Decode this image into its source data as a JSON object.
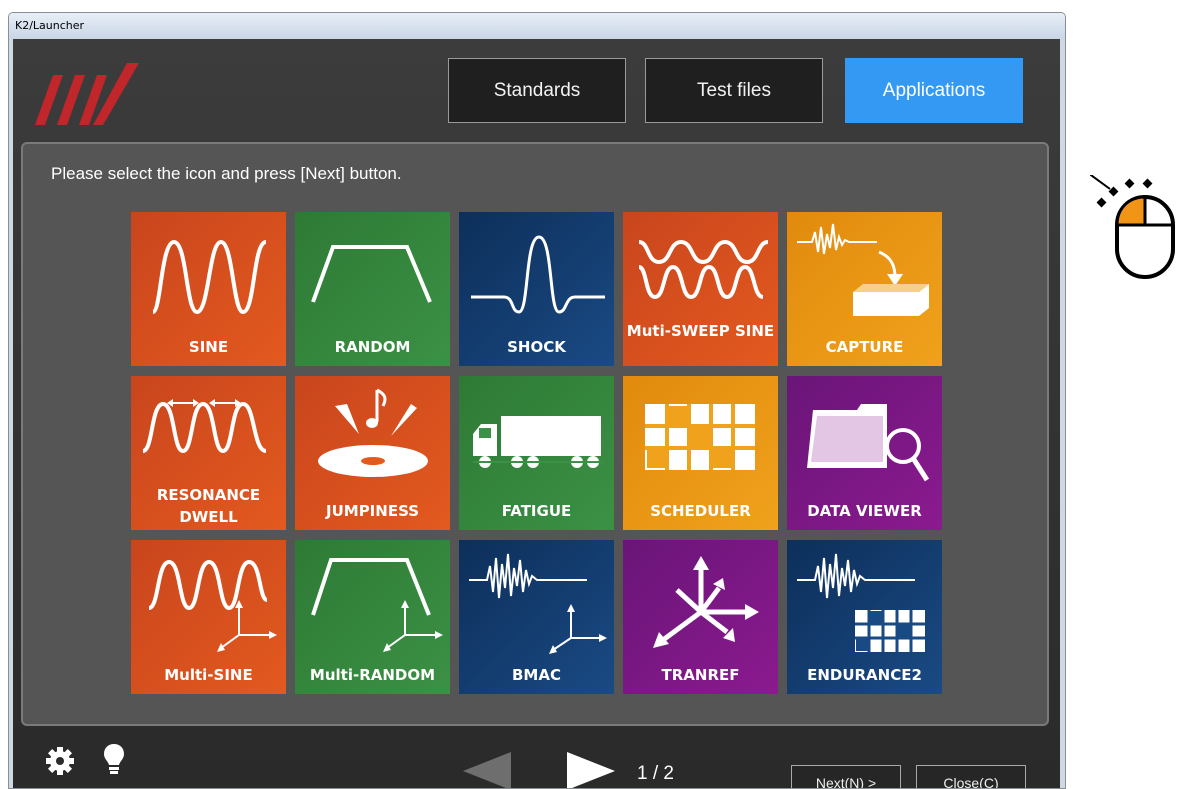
{
  "window": {
    "title": "K2/Launcher"
  },
  "tabs": [
    {
      "label": "Standards",
      "active": false
    },
    {
      "label": "Test files",
      "active": false
    },
    {
      "label": "Applications",
      "active": true
    }
  ],
  "prompt": "Please select the icon and press [Next] button.",
  "tiles": [
    {
      "label": "SINE",
      "color": "#e35a1f",
      "icon": "sine-wave-icon"
    },
    {
      "label": "RANDOM",
      "color": "#3b9145",
      "icon": "random-profile-icon"
    },
    {
      "label": "SHOCK",
      "color": "#1a4a84",
      "icon": "shock-pulse-icon"
    },
    {
      "label": "Muti-SWEEP SINE",
      "color": "#e35a1f",
      "icon": "multi-sweep-wave-icon"
    },
    {
      "label": "CAPTURE",
      "color": "#f0a21c",
      "icon": "capture-icon"
    },
    {
      "label": "RESONANCE",
      "label2": "DWELL",
      "color": "#e35a1f",
      "icon": "resonance-dwell-icon"
    },
    {
      "label": "JUMPINESS",
      "color": "#e35a1f",
      "icon": "jumpiness-disc-icon"
    },
    {
      "label": "FATIGUE",
      "color": "#3b9145",
      "icon": "truck-icon"
    },
    {
      "label": "SCHEDULER",
      "color": "#f0a21c",
      "icon": "scheduler-grid-icon"
    },
    {
      "label": "DATA VIEWER",
      "color": "#8b1a8f",
      "icon": "folder-magnifier-icon"
    },
    {
      "label": "Multi-SINE",
      "color": "#e35a1f",
      "icon": "multi-sine-axes-icon"
    },
    {
      "label": "Multi-RANDOM",
      "color": "#3b9145",
      "icon": "multi-random-axes-icon"
    },
    {
      "label": "BMAC",
      "color": "#1a4a84",
      "icon": "bmac-signal-axes-icon"
    },
    {
      "label": "TRANREF",
      "color": "#8b1a8f",
      "icon": "tranref-arrows-icon"
    },
    {
      "label": "ENDURANCE2",
      "color": "#1a4a84",
      "icon": "endurance-signal-grid-icon"
    }
  ],
  "footer": {
    "page": "1 / 2",
    "next_label": "Next(N) >",
    "close_label": "Close(C)"
  }
}
